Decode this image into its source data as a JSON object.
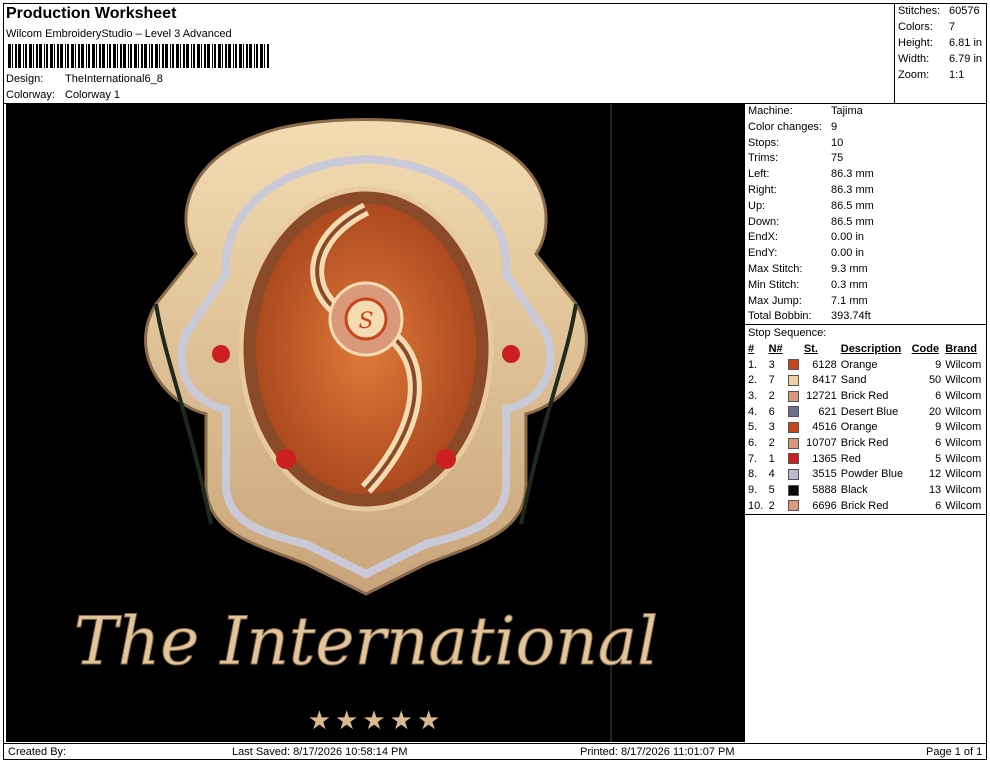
{
  "header": {
    "title": "Production Worksheet",
    "subtitle": "Wilcom EmbroideryStudio – Level 3 Advanced",
    "design_label": "Design:",
    "design_value": "TheInternational6_8",
    "colorway_label": "Colorway:",
    "colorway_value": "Colorway 1"
  },
  "summary": {
    "stitches_label": "Stitches:",
    "stitches_value": "60576",
    "colors_label": "Colors:",
    "colors_value": "7",
    "height_label": "Height:",
    "height_value": "6.81 in",
    "width_label": "Width:",
    "width_value": "6.79 in",
    "zoom_label": "Zoom:",
    "zoom_value": "1:1"
  },
  "machine_info": [
    {
      "label": "Machine:",
      "value": "Tajima"
    },
    {
      "label": "Color changes:",
      "value": "9"
    },
    {
      "label": "Stops:",
      "value": "10"
    },
    {
      "label": "Trims:",
      "value": "75"
    },
    {
      "label": "Left:",
      "value": "86.3 mm"
    },
    {
      "label": "Right:",
      "value": "86.3 mm"
    },
    {
      "label": "Up:",
      "value": "86.5 mm"
    },
    {
      "label": "Down:",
      "value": "86.5 mm"
    },
    {
      "label": "EndX:",
      "value": "0.00 in"
    },
    {
      "label": "EndY:",
      "value": "0.00 in"
    },
    {
      "label": "Max Stitch:",
      "value": "9.3 mm"
    },
    {
      "label": "Min Stitch:",
      "value": "0.3 mm"
    },
    {
      "label": "Max Jump:",
      "value": "7.1 mm"
    },
    {
      "label": "Total Bobbin:",
      "value": "393.74ft"
    }
  ],
  "stop_sequence": {
    "heading": "Stop Sequence:",
    "columns": {
      "idx": "#",
      "needle": "N#",
      "stitches": "St.",
      "description": "Description",
      "code": "Code",
      "brand": "Brand"
    },
    "rows": [
      {
        "idx": "1.",
        "needle": "3",
        "color": "#c8441a",
        "stitches": "6128",
        "description": "Orange",
        "code": "9",
        "brand": "Wilcom"
      },
      {
        "idx": "2.",
        "needle": "7",
        "color": "#f0cfa0",
        "stitches": "8417",
        "description": "Sand",
        "code": "50",
        "brand": "Wilcom"
      },
      {
        "idx": "3.",
        "needle": "2",
        "color": "#d9997a",
        "stitches": "12721",
        "description": "Brick Red",
        "code": "6",
        "brand": "Wilcom"
      },
      {
        "idx": "4.",
        "needle": "6",
        "color": "#6a7290",
        "stitches": "621",
        "description": "Desert Blue",
        "code": "20",
        "brand": "Wilcom"
      },
      {
        "idx": "5.",
        "needle": "3",
        "color": "#c8441a",
        "stitches": "4516",
        "description": "Orange",
        "code": "9",
        "brand": "Wilcom"
      },
      {
        "idx": "6.",
        "needle": "2",
        "color": "#d9997a",
        "stitches": "10707",
        "description": "Brick Red",
        "code": "6",
        "brand": "Wilcom"
      },
      {
        "idx": "7.",
        "needle": "1",
        "color": "#cc1f1f",
        "stitches": "1365",
        "description": "Red",
        "code": "5",
        "brand": "Wilcom"
      },
      {
        "idx": "8.",
        "needle": "4",
        "color": "#b9b9d4",
        "stitches": "3515",
        "description": "Powder Blue",
        "code": "12",
        "brand": "Wilcom"
      },
      {
        "idx": "9.",
        "needle": "5",
        "color": "#0a0a0a",
        "stitches": "5888",
        "description": "Black",
        "code": "13",
        "brand": "Wilcom"
      },
      {
        "idx": "10.",
        "needle": "2",
        "color": "#d9997a",
        "stitches": "6696",
        "description": "Brick Red",
        "code": "6",
        "brand": "Wilcom"
      }
    ]
  },
  "design_preview": {
    "wordmark": "The International",
    "stars": "★★★★★",
    "background": "#000000"
  },
  "footer": {
    "created_by": "Created By:",
    "last_saved": "Last Saved: 8/17/2026 10:58:14 PM",
    "printed": "Printed: 8/17/2026 11:01:07 PM",
    "page": "Page 1 of 1"
  }
}
